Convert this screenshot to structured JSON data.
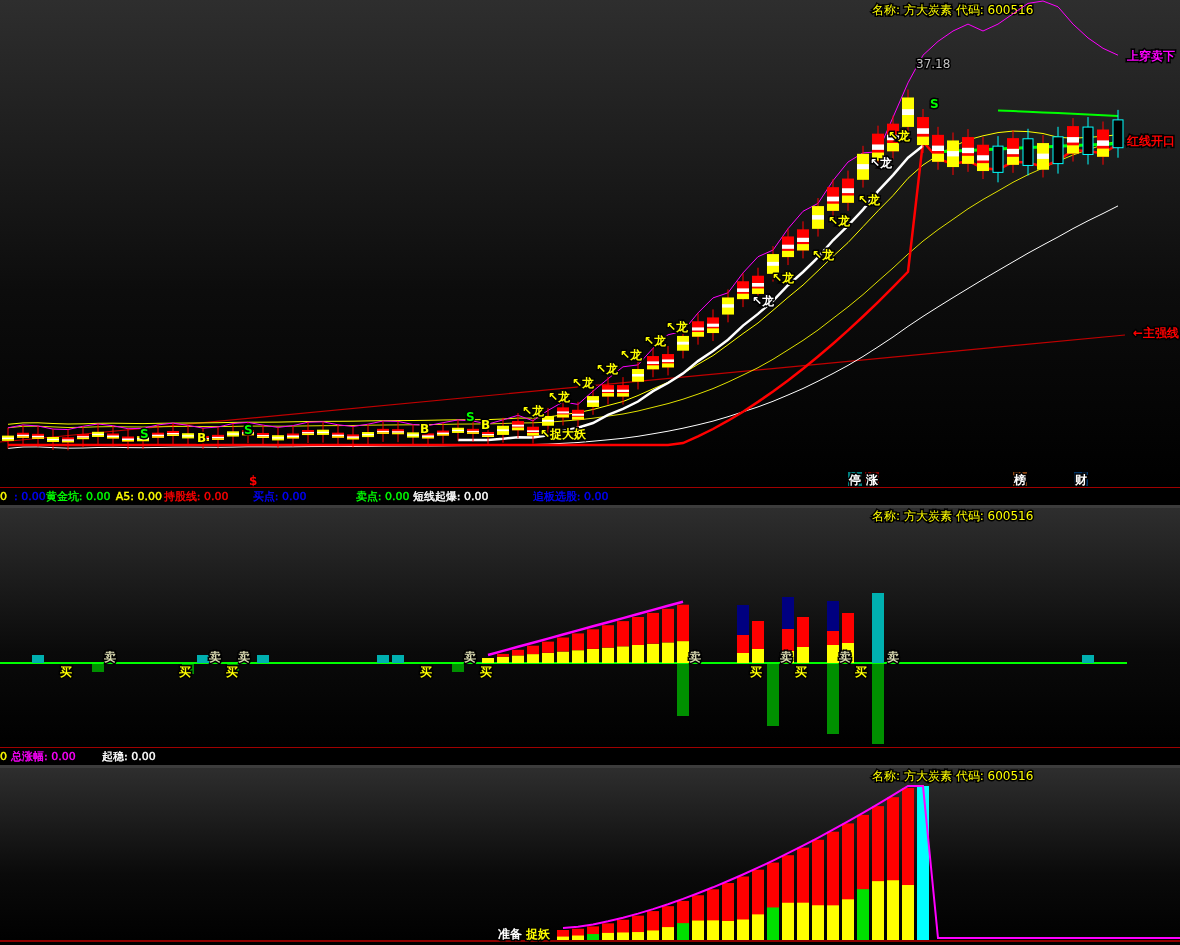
{
  "main_panel": {
    "title": "名称: 方大炭素 代码: 600516",
    "peak_label": "37.18",
    "line_labels": [
      {
        "text": "上穿卖下",
        "color": "#ff00ff"
      },
      {
        "text": "红线开口",
        "color": "#ff0000"
      },
      {
        "text": "←主强线",
        "color": "#ff0000"
      }
    ],
    "dragon_marks": [
      {
        "text": "↖龙",
        "color": "#ffff00"
      },
      {
        "text": "↖龙",
        "color": "#ffff00"
      },
      {
        "text": "↖龙",
        "color": "#ffff00"
      },
      {
        "text": "↖龙",
        "color": "#ffff00"
      },
      {
        "text": "↖龙",
        "color": "#ffff00"
      },
      {
        "text": "↖龙",
        "color": "#ffff00"
      },
      {
        "text": "↖龙",
        "color": "#ffff00"
      },
      {
        "text": "↖龙",
        "color": "#ffffff"
      },
      {
        "text": "↖龙",
        "color": "#ffff00"
      },
      {
        "text": "↖龙",
        "color": "#ffff00"
      },
      {
        "text": "↖龙",
        "color": "#ffff00"
      },
      {
        "text": "↖龙",
        "color": "#ffff00"
      },
      {
        "text": "↖龙",
        "color": "#ffffff"
      },
      {
        "text": "↖龙",
        "color": "#ffff00"
      }
    ],
    "trend_mark": "↖捉大妖",
    "signals": [
      {
        "kind": "sell",
        "text": "S"
      },
      {
        "kind": "buy",
        "text": "B"
      },
      {
        "kind": "sell",
        "text": "S"
      },
      {
        "kind": "buy",
        "text": "B"
      },
      {
        "kind": "sell",
        "text": "S"
      },
      {
        "kind": "buy",
        "text": "B"
      },
      {
        "kind": "sell",
        "text": "S"
      }
    ],
    "dollar_mark": "$",
    "badges": [
      {
        "text": "停",
        "color": "#008080"
      },
      {
        "text": "涨",
        "color": "#800000"
      },
      {
        "text": "榜",
        "color": "#8b4513"
      },
      {
        "text": "财",
        "color": "#003366"
      }
    ]
  },
  "legend_1": [
    {
      "text": "0",
      "color": "#ffff00"
    },
    {
      "text": ": 0.00",
      "color": "#0000ff"
    },
    {
      "text": "黄金坑: 0.00",
      "color": "#00ff00"
    },
    {
      "text": "A5: 0.00",
      "color": "#ffff00"
    },
    {
      "text": "持股线: 0.00",
      "color": "#ff0000"
    },
    {
      "text": "买点: 0.00",
      "color": "#0000ff"
    },
    {
      "text": "卖点: 0.00",
      "color": "#00ff00"
    },
    {
      "text": "短线起爆: 0.00",
      "color": "#ffffff"
    },
    {
      "text": "追板选股: 0.00",
      "color": "#0000ff"
    }
  ],
  "signal_panel": {
    "title": "名称: 方大炭素 代码: 600516",
    "signals": [
      {
        "kind": "buy",
        "text": "买"
      },
      {
        "kind": "sell",
        "text": "卖"
      },
      {
        "kind": "buy",
        "text": "买"
      },
      {
        "kind": "sell",
        "text": "卖"
      },
      {
        "kind": "buy",
        "text": "买"
      },
      {
        "kind": "sell",
        "text": "卖"
      },
      {
        "kind": "buy",
        "text": "买"
      },
      {
        "kind": "sell",
        "text": "卖"
      },
      {
        "kind": "buy",
        "text": "买"
      },
      {
        "kind": "sell",
        "text": "卖"
      },
      {
        "kind": "buy",
        "text": "买"
      },
      {
        "kind": "sell",
        "text": "卖"
      },
      {
        "kind": "buy",
        "text": "买"
      },
      {
        "kind": "sell",
        "text": "卖"
      },
      {
        "kind": "buy",
        "text": "买"
      },
      {
        "kind": "sell",
        "text": "卖"
      }
    ]
  },
  "legend_2": [
    {
      "text": "0",
      "color": "#ffff00"
    },
    {
      "text": "总涨幅: 0.00",
      "color": "#ff00ff"
    },
    {
      "text": "起稳: 0.00",
      "color": "#ffffff"
    }
  ],
  "volume_panel": {
    "title": "名称: 方大炭素 代码: 600516",
    "labels": [
      {
        "text": "准备",
        "color": "#ffffff"
      },
      {
        "text": "捉妖",
        "color": "#ffff00"
      }
    ]
  }
}
